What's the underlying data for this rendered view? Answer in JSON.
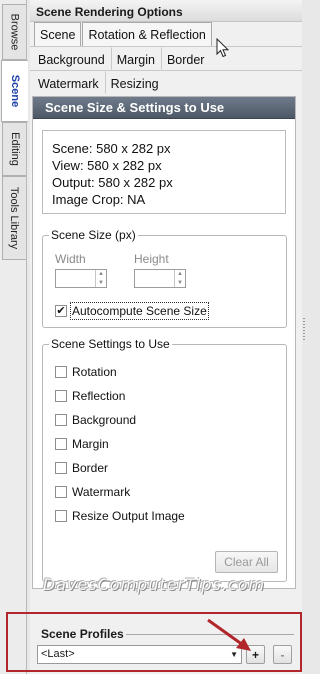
{
  "side_tabs": [
    {
      "label": "Browse"
    },
    {
      "label": "Scene"
    },
    {
      "label": "Editing"
    },
    {
      "label": "Tools Library"
    }
  ],
  "panel": {
    "title": "Scene Rendering Options",
    "tabs_row1": [
      "Scene",
      "Rotation & Reflection"
    ],
    "tabs_row2": [
      "Background",
      "Margin",
      "Border"
    ],
    "tabs_row3": [
      "Watermark",
      "Resizing"
    ]
  },
  "section": {
    "header": "Scene Size & Settings to Use",
    "info": {
      "scene": "Scene: 580 x 282 px",
      "view": "View: 580 x 282 px",
      "output": "Output: 580 x 282 px",
      "crop": "Image Crop: NA"
    },
    "scene_size": {
      "legend": "Scene Size (px)",
      "width_label": "Width",
      "height_label": "Height",
      "autocompute_label": "Autocompute Scene Size",
      "autocompute_checked": true
    },
    "settings": {
      "legend": "Scene Settings to Use",
      "items": [
        "Rotation",
        "Reflection",
        "Background",
        "Margin",
        "Border",
        "Watermark",
        "Resize Output Image"
      ],
      "clear_all_label": "Clear All"
    }
  },
  "watermark_text": "DavesComputerTips.com",
  "profiles": {
    "label": "Scene Profiles",
    "selected": "<Last>",
    "add_label": "+",
    "remove_label": "-"
  },
  "colors": {
    "section_header": "#5d6878",
    "highlight_box": "#b0262b",
    "active_side_tab": "#1b3fa8"
  }
}
